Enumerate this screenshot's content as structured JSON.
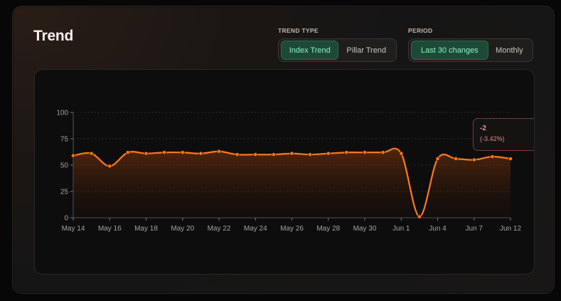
{
  "card": {
    "title": "Trend"
  },
  "controls": {
    "trend_type": {
      "label": "TREND TYPE",
      "options": [
        "Index Trend",
        "Pillar Trend"
      ],
      "selected": "Index Trend"
    },
    "period": {
      "label": "PERIOD",
      "options": [
        "Last 30 changes",
        "Monthly"
      ],
      "selected": "Last 30 changes"
    }
  },
  "tooltip": {
    "value": "-2",
    "percent": "(-3.42%)"
  },
  "colors": {
    "line": "#ff7a1a",
    "active_button_bg": "#1c4a37",
    "active_button_text": "#8ff0bf",
    "tooltip_border": "#7a3b3b",
    "tooltip_text": "#f08f8f"
  },
  "chart_data": {
    "type": "area",
    "ylim": [
      0,
      100
    ],
    "yticks": [
      0,
      25,
      50,
      75,
      100
    ],
    "grid": true,
    "x_tick_labels": [
      "May 14",
      "May 16",
      "May 18",
      "May 20",
      "May 22",
      "May 24",
      "May 26",
      "May 28",
      "May 30",
      "Jun 1",
      "Jun 4",
      "Jun 7",
      "Jun 12"
    ],
    "series": [
      {
        "values": [
          59,
          61,
          49,
          62,
          61,
          62,
          62,
          61,
          63,
          60,
          60,
          60,
          61,
          60,
          61,
          62,
          62,
          62,
          61,
          1,
          56,
          56,
          55,
          58,
          56
        ]
      }
    ]
  }
}
